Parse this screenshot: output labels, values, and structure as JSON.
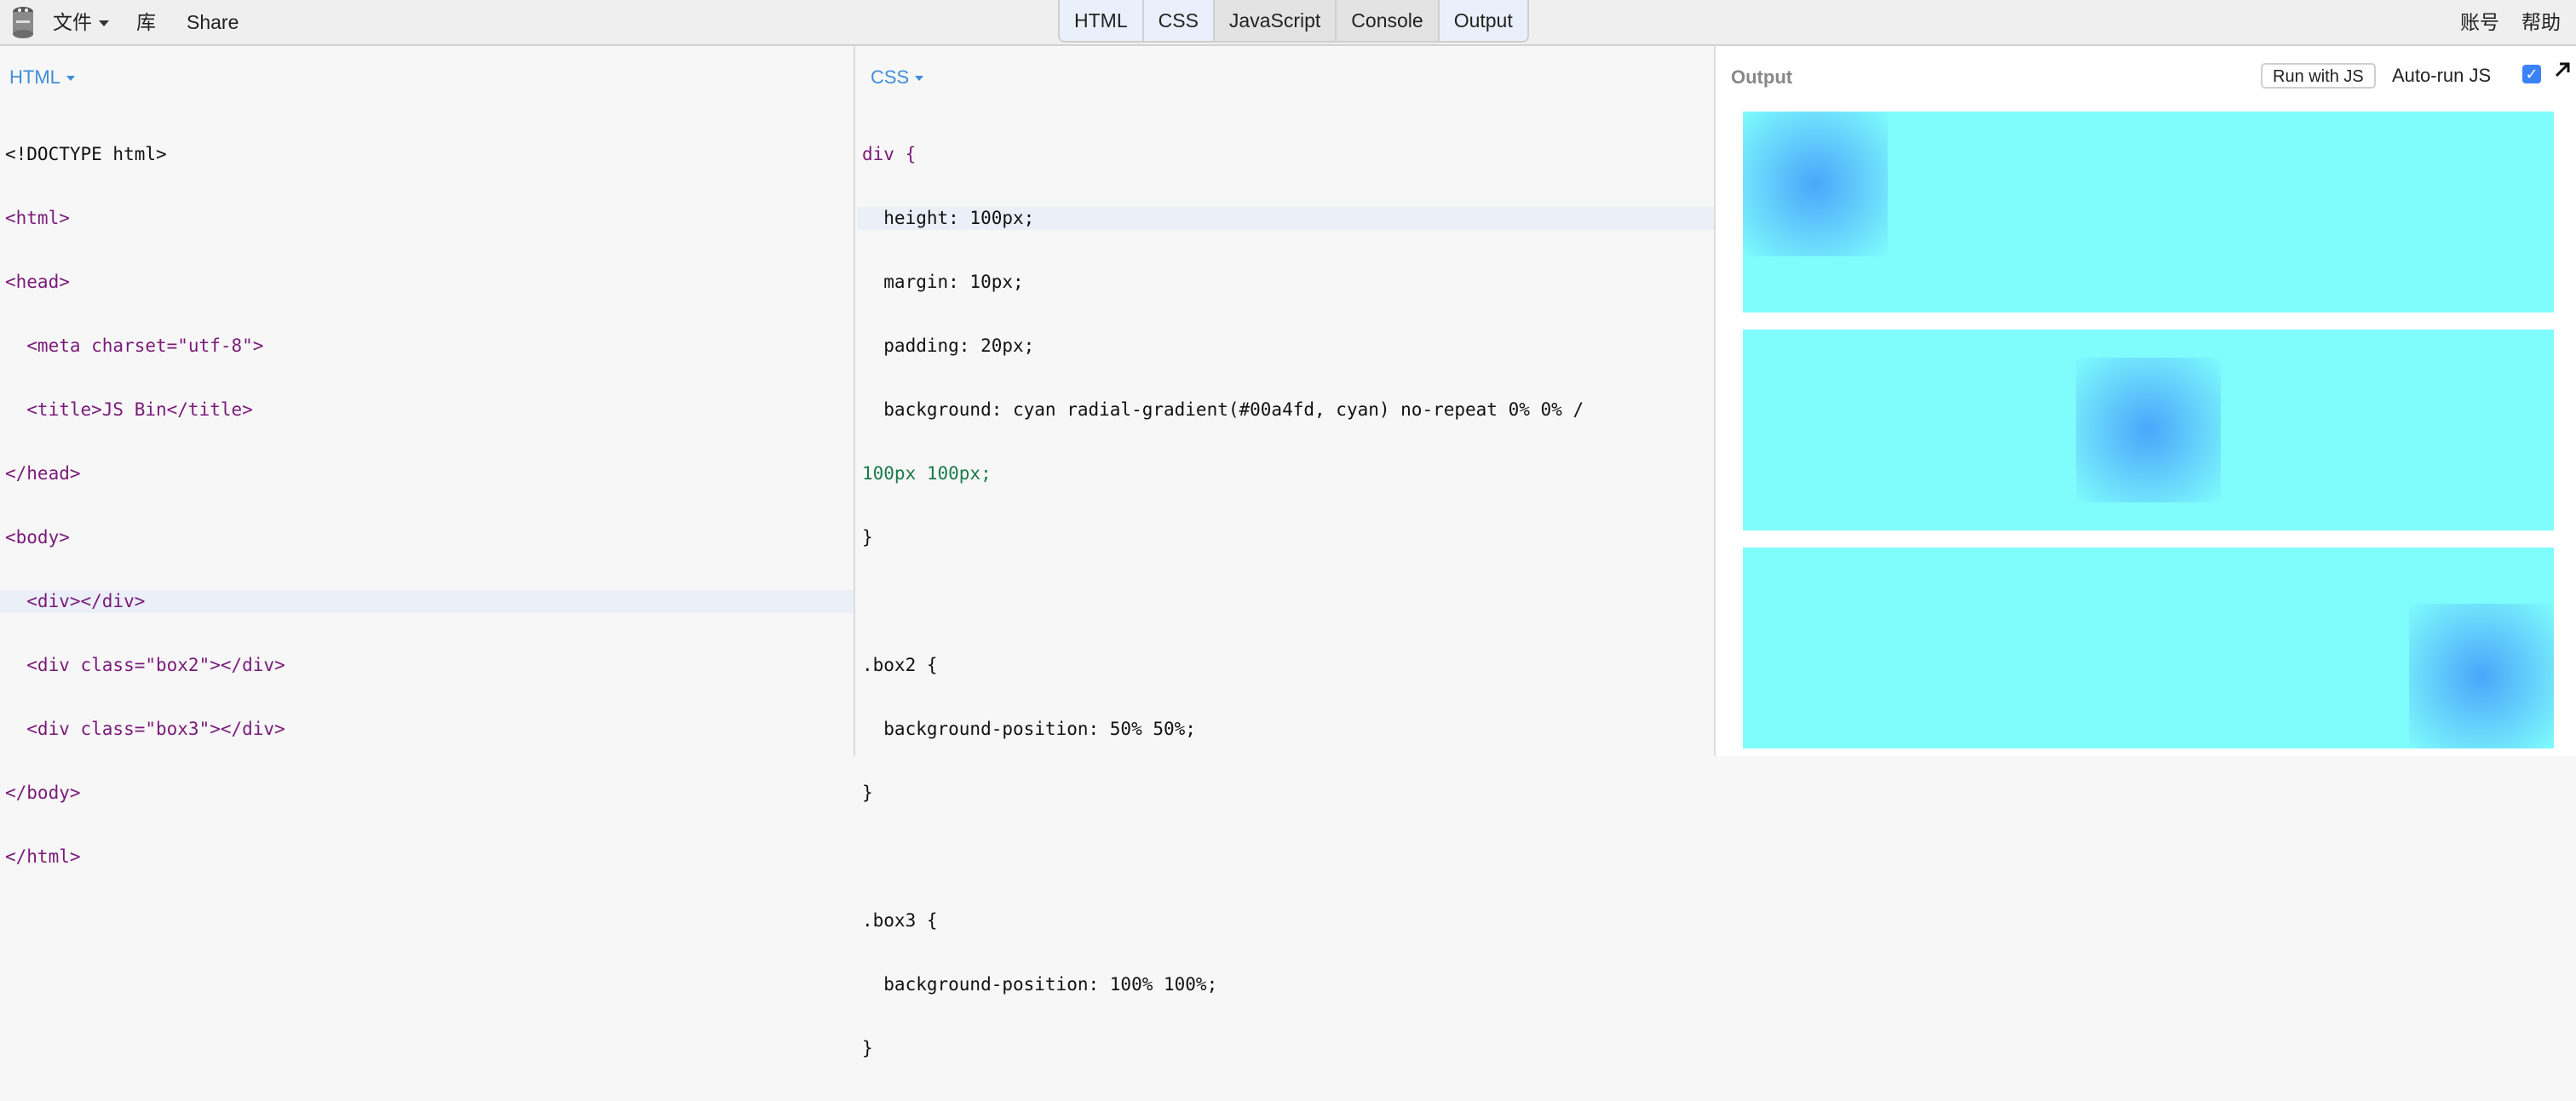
{
  "topbar": {
    "file_menu": "文件",
    "library": "库",
    "share": "Share",
    "tabs": [
      "HTML",
      "CSS",
      "JavaScript",
      "Console",
      "Output"
    ],
    "account": "账号",
    "help": "帮助"
  },
  "html_panel": {
    "label": "HTML",
    "lines": [
      "<!DOCTYPE html>",
      "<html>",
      "<head>",
      "  <meta charset=\"utf-8\">",
      "  <title>JS Bin</title>",
      "</head>",
      "<body>",
      "  <div></div>",
      "  <div class=\"box2\"></div>",
      "  <div class=\"box3\"></div>",
      "</body>",
      "</html>"
    ]
  },
  "css_panel": {
    "label": "CSS",
    "lines": [
      "div {",
      "  height: 100px;",
      "  margin: 10px;",
      "  padding: 20px;",
      "  background: cyan radial-gradient(#00a4fd, cyan) no-repeat 0% 0% /",
      "100px 100px;",
      "}",
      "",
      ".box2 {",
      "  background-position: 50% 50%;",
      "}",
      "",
      ".box3 {",
      "  background-position: 100% 100%;",
      "}"
    ]
  },
  "output_panel": {
    "title": "Output",
    "run_button": "Run with JS",
    "autorun_label": "Auto-run JS",
    "autorun_checked": true
  },
  "colors": {
    "accent": "#3e8ed8",
    "cyan": "#00ffff",
    "gradient_center": "#00a4fd"
  }
}
